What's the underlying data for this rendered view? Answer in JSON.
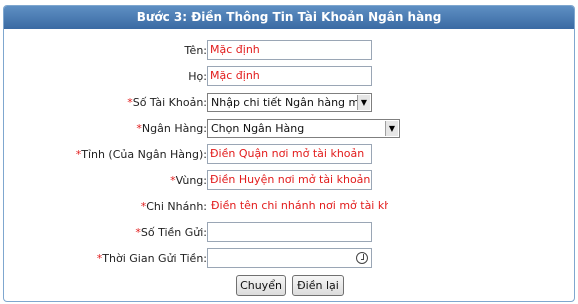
{
  "header": {
    "title": "Bước 3: Điền Thông Tin Tài Khoản Ngân hàng"
  },
  "form": {
    "ten": {
      "label": "Tên:",
      "value": "Mặc định"
    },
    "ho": {
      "label": "Họ:",
      "value": "Mặc định"
    },
    "so_tai_khoan": {
      "required": "*",
      "label": "Số Tài Khoản:",
      "selected": "Nhập chi tiết Ngân hàng mới"
    },
    "ngan_hang": {
      "required": "*",
      "label": "Ngân Hàng:",
      "selected": "Chọn Ngân Hàng"
    },
    "tinh": {
      "required": "*",
      "label": "Tỉnh (Của Ngân Hàng):",
      "value": "Điền Quận nơi mở tài khoản"
    },
    "vung": {
      "required": "*",
      "label": "Vùng:",
      "value": "Điền Huyện nơi mở tài khoản"
    },
    "chi_nhanh": {
      "required": "*",
      "label": "Chi Nhánh:",
      "value": "Điền tên chi nhánh nơi mở tài khoản"
    },
    "so_tien_gui": {
      "required": "*",
      "label": "Số Tiền Gửi:",
      "value": ""
    },
    "thoi_gian_gui_tien": {
      "required": "*",
      "label": "Thời Gian Gửi Tiền:",
      "value": ""
    }
  },
  "buttons": {
    "submit_label": "Chuyển",
    "reset_label": "Điền lại"
  },
  "colors": {
    "header_bg": "#3a6aa3",
    "required_marker": "#e21c1c",
    "hint_text": "#e21c1c",
    "border": "#7fa7cf"
  }
}
